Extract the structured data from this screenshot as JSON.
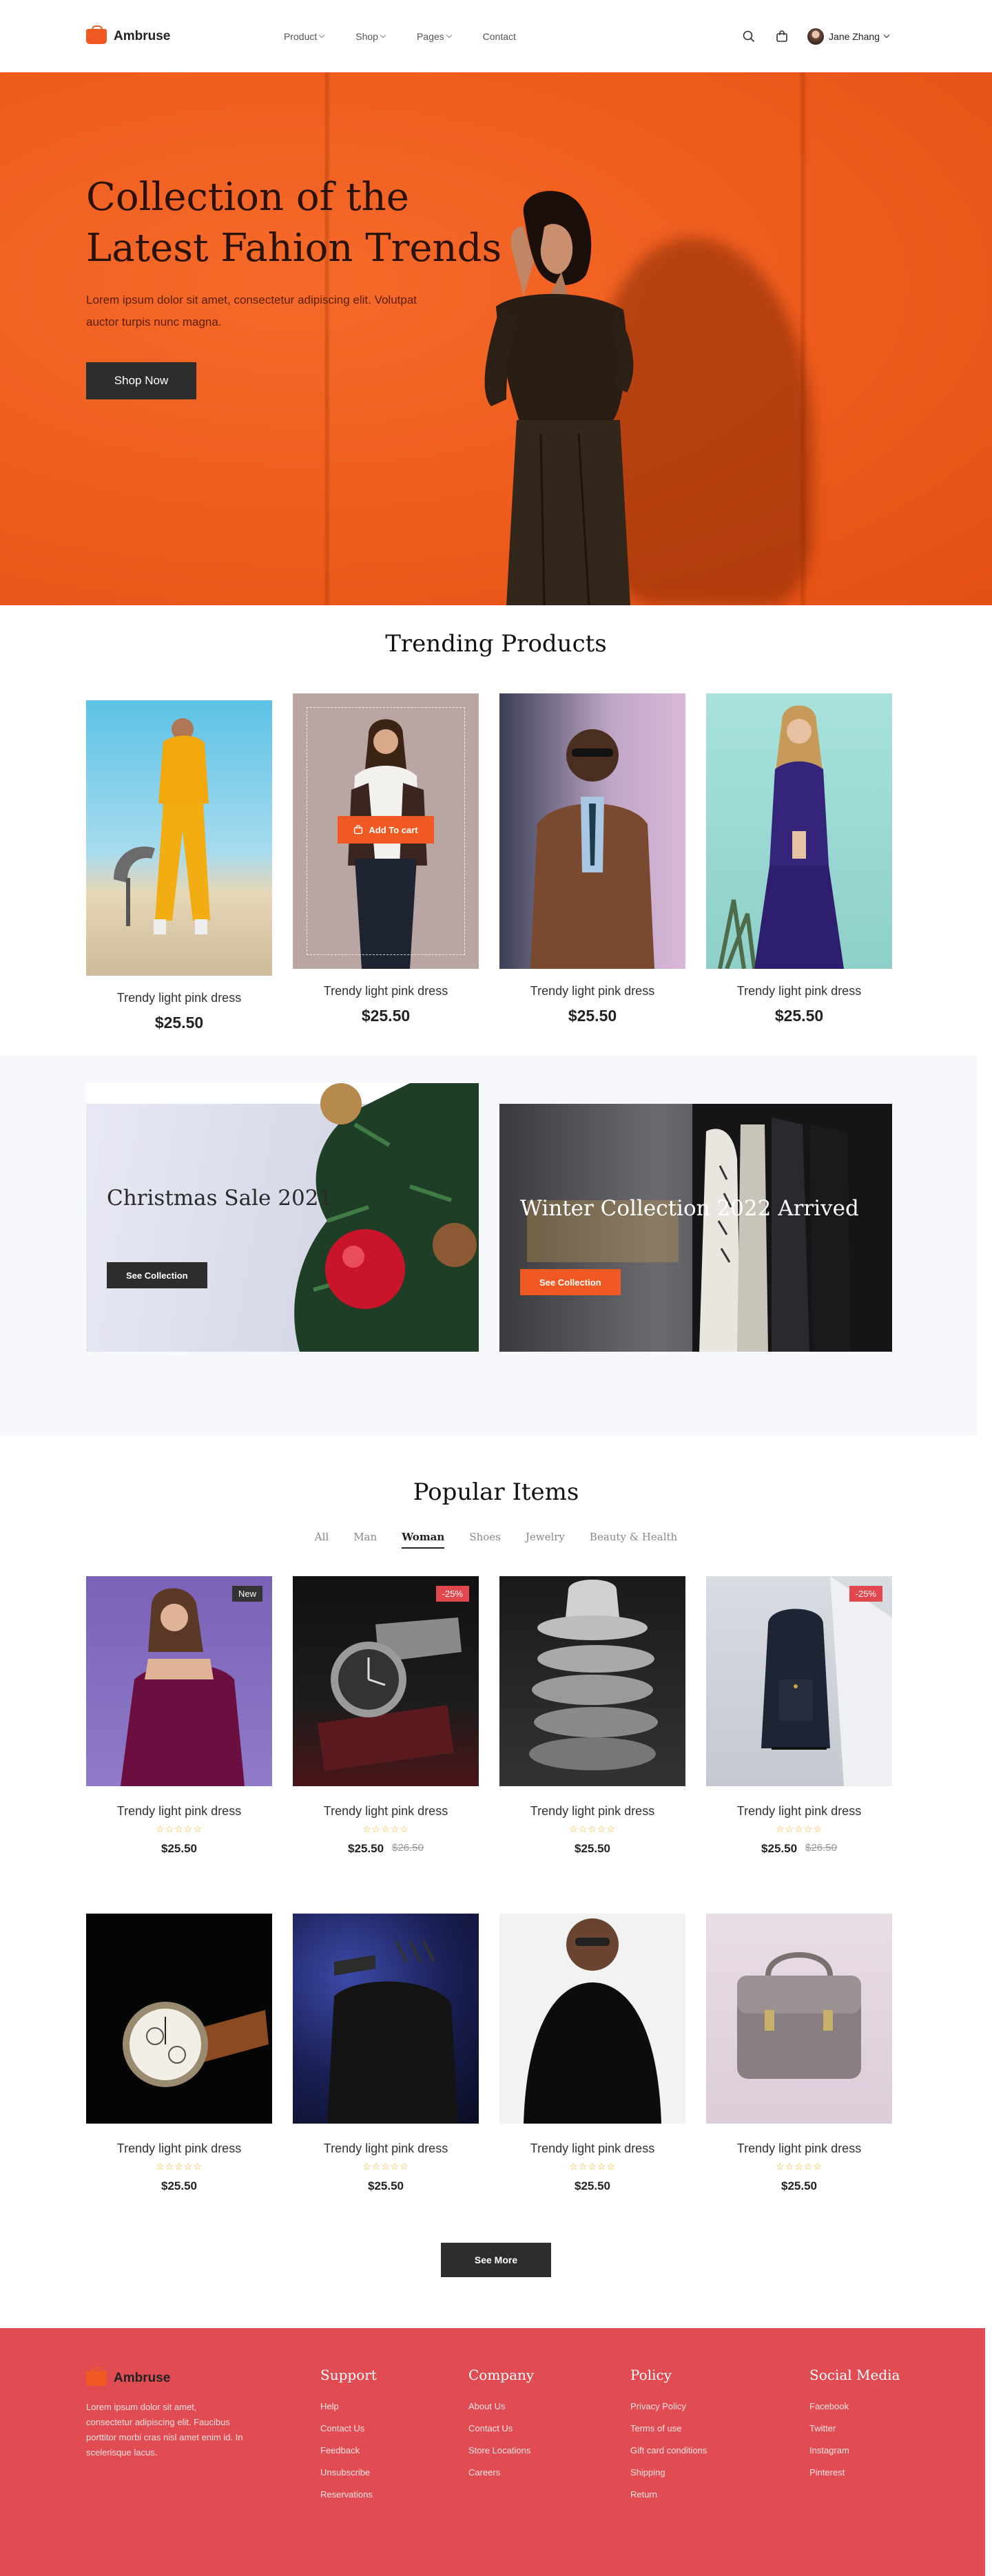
{
  "nav": {
    "brand": "Ambruse",
    "links": [
      {
        "label": "Product",
        "dropdown": true
      },
      {
        "label": "Shop",
        "dropdown": true
      },
      {
        "label": "Pages",
        "dropdown": true
      },
      {
        "label": "Contact",
        "dropdown": false
      }
    ],
    "icons": [
      "search-icon",
      "cart-icon"
    ],
    "user_name": "Jane Zhang"
  },
  "hero": {
    "title": "Collection of the Latest Fahion Trends",
    "subtitle": "Lorem ipsum dolor sit amet, consectetur adipiscing elit. Volutpat auctor turpis nunc magna.",
    "button": "Shop Now",
    "background_color": "#ef5a1f"
  },
  "trending": {
    "title": "Trending Products",
    "add_to_cart": "Add To cart",
    "products": [
      {
        "name": "Trendy light pink dress",
        "price": "$25.50"
      },
      {
        "name": "Trendy light pink dress",
        "price": "$25.50"
      },
      {
        "name": "Trendy light pink dress",
        "price": "$25.50"
      },
      {
        "name": "Trendy light pink dress",
        "price": "$25.50"
      }
    ]
  },
  "promos": [
    {
      "title": "Christmas Sale 2021",
      "button": "See Collection"
    },
    {
      "title": "Winter Collection 2022 Arrived",
      "button": "See Collection"
    }
  ],
  "popular": {
    "title": "Popular Items",
    "tabs": [
      "All",
      "Man",
      "Woman",
      "Shoes",
      "Jewelry",
      "Beauty & Health"
    ],
    "active_tab": "Woman",
    "rating_stars": "☆☆☆☆☆",
    "items": [
      {
        "name": "Trendy light pink dress",
        "price": "$25.50",
        "old_price": "",
        "badge": "New"
      },
      {
        "name": "Trendy light pink dress",
        "price": "$25.50",
        "old_price": "$26.50",
        "badge": "-25%"
      },
      {
        "name": "Trendy light pink dress",
        "price": "$25.50",
        "old_price": "",
        "badge": ""
      },
      {
        "name": "Trendy light pink dress",
        "price": "$25.50",
        "old_price": "$26.50",
        "badge": "-25%"
      },
      {
        "name": "Trendy light pink dress",
        "price": "$25.50",
        "old_price": "",
        "badge": ""
      },
      {
        "name": "Trendy light pink dress",
        "price": "$25.50",
        "old_price": "",
        "badge": ""
      },
      {
        "name": "Trendy light pink dress",
        "price": "$25.50",
        "old_price": "",
        "badge": ""
      },
      {
        "name": "Trendy light pink dress",
        "price": "$25.50",
        "old_price": "",
        "badge": ""
      }
    ],
    "see_more": "See More"
  },
  "footer": {
    "brand": "Ambruse",
    "description": "Lorem ipsum dolor sit amet, consectetur adipiscing elit. Faucibus porttitor morbi cras nisl amet enim id. In scelerisque lacus.",
    "columns": [
      {
        "title": "Support",
        "links": [
          "Help",
          "Contact Us",
          "Feedback",
          "Unsubscribe",
          "Reservations"
        ]
      },
      {
        "title": "Company",
        "links": [
          "About Us",
          "Contact Us",
          "Store Locations",
          "Careers"
        ]
      },
      {
        "title": "Policy",
        "links": [
          "Privacy Policy",
          "Terms of use",
          "Gift card conditions",
          "Shipping",
          "Return"
        ]
      },
      {
        "title": "Social Media",
        "links": [
          "Facebook",
          "Twitter",
          "Instagram",
          "Pinterest"
        ]
      }
    ],
    "background_color": "#e14c53"
  }
}
